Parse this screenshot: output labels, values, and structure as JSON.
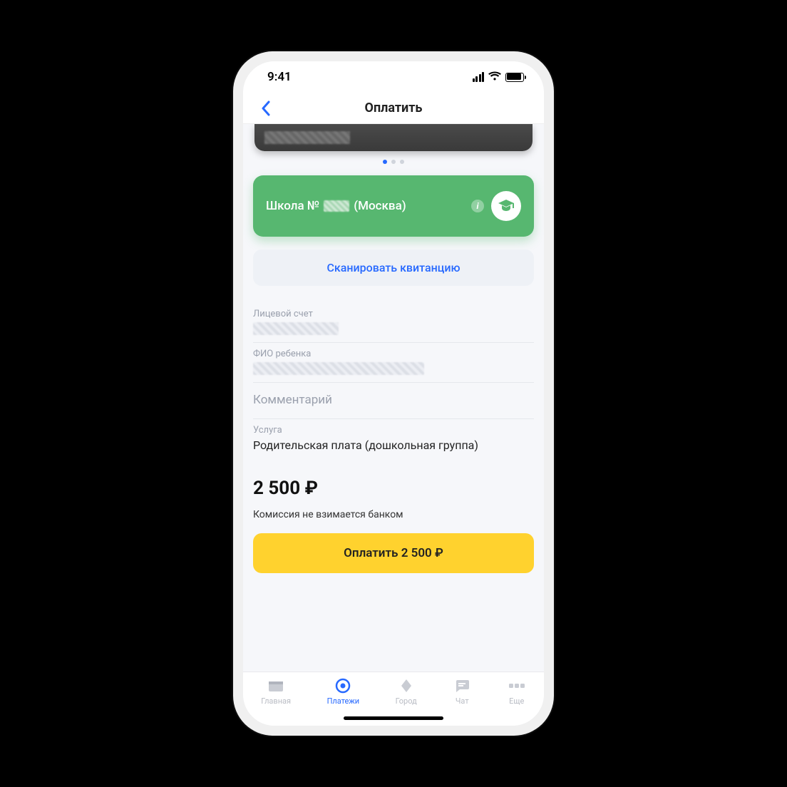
{
  "status": {
    "time": "9:41"
  },
  "nav": {
    "title": "Оплатить"
  },
  "payee": {
    "prefix": "Школа №",
    "suffix": "(Москва)"
  },
  "scan": {
    "label": "Сканировать квитанцию"
  },
  "fields": {
    "account_label": "Лицевой счет",
    "child_label": "ФИО ребенка",
    "comment_placeholder": "Комментарий",
    "service_label": "Услуга",
    "service_value": "Родительская плата (дошкольная группа)"
  },
  "amount": {
    "display": "2 500 ₽"
  },
  "fee": {
    "note": "Комиссия не взимается банком"
  },
  "pay": {
    "label": "Оплатить 2 500 ₽"
  },
  "tabs": {
    "home": "Главная",
    "payments": "Платежи",
    "city": "Город",
    "chat": "Чат",
    "more": "Еще"
  }
}
